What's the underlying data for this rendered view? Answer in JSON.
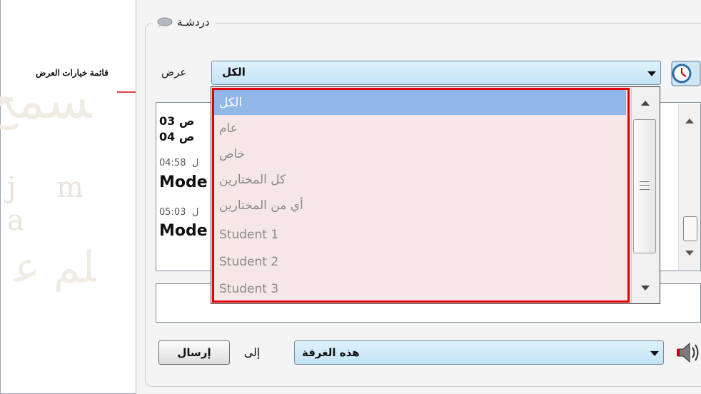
{
  "annotation": {
    "text": "قائمة خيارات العرض"
  },
  "chat": {
    "title": "دردشـة",
    "show_label": "عرض",
    "show_selected": "الكل",
    "dropdown_options": [
      {
        "label": "الكل",
        "selected": true
      },
      {
        "label": "عام",
        "selected": false
      },
      {
        "label": "خاص",
        "selected": false
      },
      {
        "label": "كل المختارين",
        "selected": false
      },
      {
        "label": "أي من المختارين",
        "selected": false
      },
      {
        "label": "Student 1",
        "selected": false
      },
      {
        "label": "Student 2",
        "selected": false
      },
      {
        "label": "Student 3",
        "selected": false
      }
    ],
    "log": {
      "line1": "03 ص",
      "line2": "04 ص",
      "line3_time": "04:58",
      "line3_suffix": "ل",
      "line4": "Mode",
      "line5_time": "05:03",
      "line5_suffix": "ل",
      "line6": "Mode"
    },
    "send_button": "إرسال",
    "to_label": "إلى",
    "recipient_selected": "هذه الغرفة"
  },
  "icons": {
    "chat_bubble": "chat-bubble-icon",
    "clock": "clock-icon",
    "speaker": "speaker-icon"
  },
  "colors": {
    "dropdown_bg": "#f5e7e7",
    "selected_option_bg": "#91b6e8",
    "highlight_border": "#e00000",
    "combo_bg": "#c3e4f6"
  }
}
